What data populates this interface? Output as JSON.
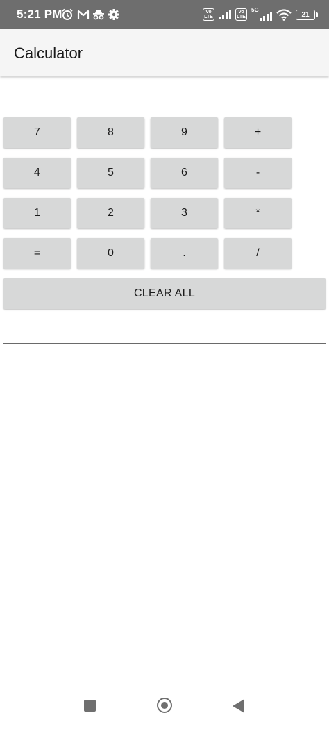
{
  "status_bar": {
    "time": "5:21 PM",
    "icons": [
      "alarm-icon",
      "gmail-icon",
      "incognito-icon",
      "settings-gear-icon"
    ],
    "volte1": "Vo LTE",
    "volte2": "Vo LTE",
    "network": "5G",
    "battery": "21"
  },
  "app_bar": {
    "title": "Calculator"
  },
  "display": {
    "value": "",
    "result": ""
  },
  "keypad": {
    "rows": [
      [
        "7",
        "8",
        "9",
        "+"
      ],
      [
        "4",
        "5",
        "6",
        "-"
      ],
      [
        "1",
        "2",
        "3",
        "*"
      ],
      [
        "=",
        "0",
        ".",
        "/"
      ]
    ],
    "clear_label": "CLEAR ALL"
  },
  "colors": {
    "status_bar": "#6e6e6e",
    "app_bar": "#f5f5f5",
    "key_bg": "#d7d8d8",
    "text": "#1b1b1b"
  },
  "nav_bar": {
    "icons": [
      "recents-square-icon",
      "home-circle-icon",
      "back-triangle-icon"
    ]
  }
}
